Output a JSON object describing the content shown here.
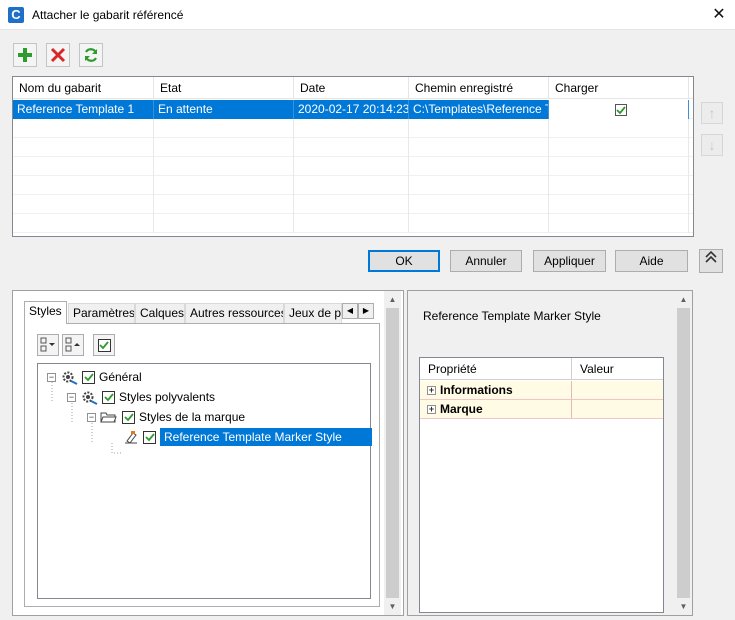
{
  "window": {
    "title": "Attacher le gabarit référencé",
    "app_icon_letter": "C"
  },
  "toolbar": {
    "add_icon": "plus-icon",
    "remove_icon": "red-x-icon",
    "refresh_icon": "refresh-icon"
  },
  "grid": {
    "headers": [
      "Nom du gabarit",
      "Etat",
      "Date",
      "Chemin enregistré",
      "Charger"
    ],
    "rows": [
      {
        "name": "Reference Template 1",
        "state": "En attente",
        "date": "2020-02-17 20:14:23",
        "path": "C:\\Templates\\Reference Template",
        "load": true
      }
    ]
  },
  "buttons": {
    "ok": "OK",
    "cancel": "Annuler",
    "apply": "Appliquer",
    "help": "Aide"
  },
  "tabs": [
    "Styles",
    "Paramètres",
    "Calques",
    "Autres ressources",
    "Jeux de propriétés"
  ],
  "active_tab": "Styles",
  "tree": {
    "root": "Général",
    "child": "Styles polyvalents",
    "grandchild": "Styles de la marque",
    "leaf": "Reference Template Marker Style"
  },
  "details": {
    "title": "Reference Template Marker Style",
    "headers": [
      "Propriété",
      "Valeur"
    ],
    "rows": [
      "Informations",
      "Marque"
    ]
  },
  "colors": {
    "selection": "#0078d7",
    "accent_green": "#2e9b2e",
    "accent_red": "#d9262a"
  }
}
